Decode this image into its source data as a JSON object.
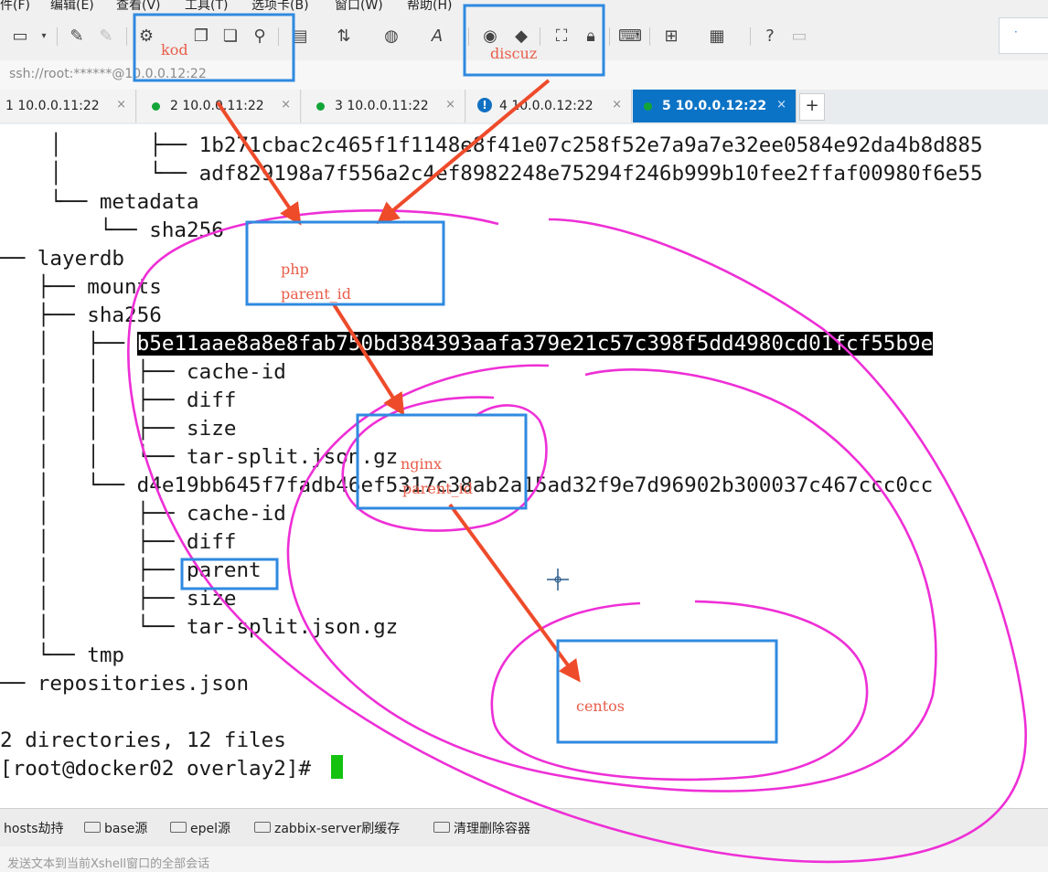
{
  "menu": [
    "件(F)",
    "编辑(E)",
    "查看(V)",
    "工具(T)",
    "选项卡(B)",
    "窗口(W)",
    "帮助(H)"
  ],
  "address": "ssh://root:******@10.0.0.12:22",
  "tabs": [
    {
      "label": "1 10.0.0.11:22",
      "close": "×"
    },
    {
      "label": "2 10.0.0.11:22",
      "close": "×"
    },
    {
      "label": "3 10.0.0.11:22",
      "close": "×"
    },
    {
      "label": "4 10.0.0.12:22",
      "close": "×",
      "warn": "!"
    },
    {
      "label": "5 10.0.0.12:22",
      "close": "×"
    }
  ],
  "new_tab": "+",
  "terminal": {
    "lines": [
      "    │       ├── 1b271cbac2c465f1f1148e8f41e07c258f52e7a9a7e32ee0584e92da4b8d885",
      "    │       └── adf829198a7f556a2c4ef8982248e75294f246b999b10fee2ffaf00980f6e55",
      "    └── metadata",
      "        └── sha256",
      "── layerdb",
      "   ├── mounts",
      "   ├── sha256",
      "   │   ├── ",
      "   │   │   ├── cache-id",
      "   │   │   ├── diff",
      "   │   │   ├── size",
      "   │   │   └── tar-split.json.gz",
      "   │   └── d4e19bb645f7fadb46ef5317c38ab2a15ad32f9e7d96902b300037c467ccc0cc",
      "   │       ├── cache-id",
      "   │       ├── diff",
      "   │       ├── parent",
      "   │       ├── size",
      "   │       └── tar-split.json.gz",
      "   └── tmp",
      "── repositories.json",
      "",
      "2 directories, 12 files",
      "[root@docker02 overlay2]# "
    ],
    "highlight": "b5e11aae8a8e8fab750bd384393aafa379e21c57c398f5dd4980cd01fcf55b9e"
  },
  "quick_commands": [
    "hosts劫持",
    "base源",
    "epel源",
    "zabbix-server刷缓存",
    "清理删除容器"
  ],
  "status_text": "发送文本到当前Xshell窗口的全部会话",
  "annotations": {
    "kod": "kod",
    "discuz": "discuz",
    "php": "php",
    "php_parent": "parent_id",
    "nginx": "nginx",
    "nginx_parent": "parent_id",
    "centos": "centos"
  },
  "colors": {
    "tab_active": "#0b73c6",
    "status_dot": "#13a538",
    "annotation_box": "#2f8ae0",
    "arrow": "#ee4b2b",
    "circle": "#ee2fd6",
    "cursor": "#14c20f"
  }
}
